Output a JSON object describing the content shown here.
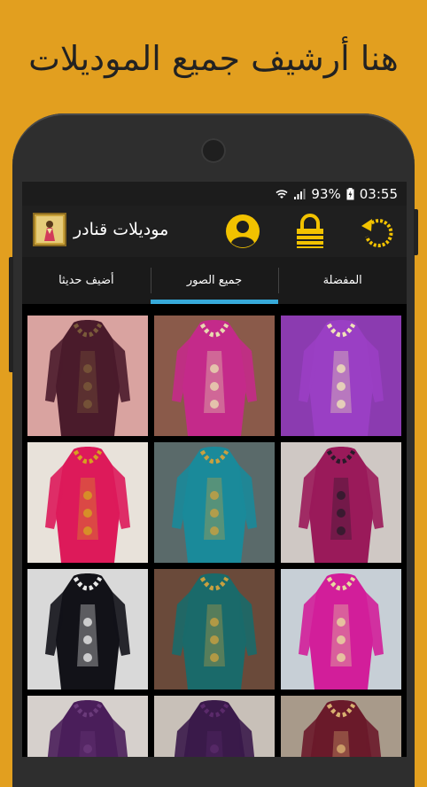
{
  "promo": {
    "title": "هنا أرشيف جميع الموديلات"
  },
  "status": {
    "battery": "93%",
    "time": "03:55"
  },
  "app": {
    "title": "موديلات قنادر"
  },
  "tabs": [
    {
      "label": "أضيف حديثا",
      "active": false
    },
    {
      "label": "جميع الصور",
      "active": true
    },
    {
      "label": "المفضلة",
      "active": false
    }
  ],
  "icons": {
    "refresh": "refresh-icon",
    "lock": "lock-icon",
    "profile": "profile-icon",
    "accent": "#f2c200",
    "tab_indicator": "#36a9d9"
  },
  "gallery": {
    "items": [
      {
        "name": "dress-photo",
        "bg": "#d9a3a0",
        "dress": "#4a1b2b",
        "trim": "#7a5a3a"
      },
      {
        "name": "dress-photo",
        "bg": "#8a5a4a",
        "dress": "#c42a8a",
        "trim": "#e8d9b0"
      },
      {
        "name": "dress-photo",
        "bg": "#8b3bb0",
        "dress": "#9a3fc4",
        "trim": "#f0e3b8"
      },
      {
        "name": "dress-photo",
        "bg": "#e8e2da",
        "dress": "#dd1a5a",
        "trim": "#d6a020"
      },
      {
        "name": "dress-photo",
        "bg": "#5a6a6a",
        "dress": "#1a8a9a",
        "trim": "#c8a040"
      },
      {
        "name": "dress-photo",
        "bg": "#cfc8c4",
        "dress": "#9a1a5a",
        "trim": "#2a1a2a"
      },
      {
        "name": "dress-photo",
        "bg": "#d9d9d9",
        "dress": "#121218",
        "trim": "#e8e8e8"
      },
      {
        "name": "dress-photo",
        "bg": "#6a4a3a",
        "dress": "#1a6a6a",
        "trim": "#c8a040"
      },
      {
        "name": "dress-photo",
        "bg": "#c7cfd6",
        "dress": "#d21e9a",
        "trim": "#e8d9a0"
      },
      {
        "name": "dress-photo",
        "bg": "#d6d0cc",
        "dress": "#4a1e5a",
        "trim": "#6a3a7a"
      },
      {
        "name": "dress-photo",
        "bg": "#c8c0b8",
        "dress": "#3a1a4a",
        "trim": "#5a2a6a"
      },
      {
        "name": "dress-photo",
        "bg": "#a89a8a",
        "dress": "#6a1a2a",
        "trim": "#d8b070"
      }
    ]
  }
}
